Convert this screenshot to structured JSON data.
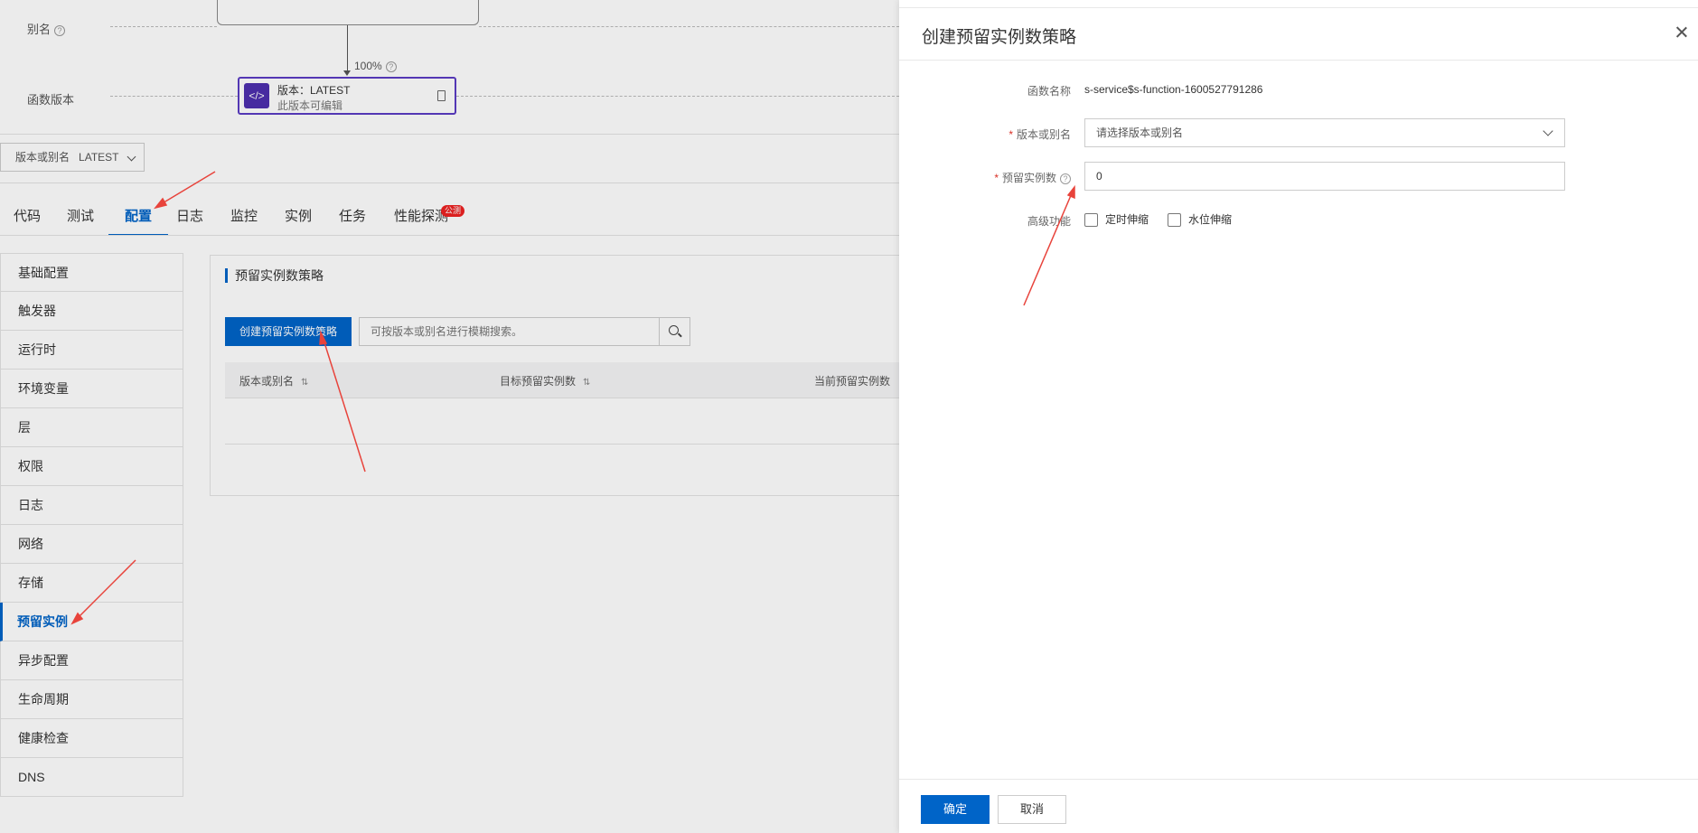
{
  "topology": {
    "alias_label": "别名",
    "version_label": "函数版本",
    "percent": "100%",
    "version_card_title": "版本：LATEST",
    "version_card_sub": "此版本可编辑"
  },
  "version_select": {
    "label": "版本或别名",
    "value": "LATEST"
  },
  "tabs": [
    {
      "label": "代码"
    },
    {
      "label": "测试"
    },
    {
      "label": "配置"
    },
    {
      "label": "日志"
    },
    {
      "label": "监控"
    },
    {
      "label": "实例"
    },
    {
      "label": "任务"
    },
    {
      "label": "性能探测"
    }
  ],
  "tab_badge": "公测",
  "sidebar": {
    "items": [
      {
        "label": "基础配置"
      },
      {
        "label": "触发器"
      },
      {
        "label": "运行时"
      },
      {
        "label": "环境变量"
      },
      {
        "label": "层"
      },
      {
        "label": "权限"
      },
      {
        "label": "日志"
      },
      {
        "label": "网络"
      },
      {
        "label": "存储"
      },
      {
        "label": "预留实例"
      },
      {
        "label": "异步配置"
      },
      {
        "label": "生命周期"
      },
      {
        "label": "健康检查"
      },
      {
        "label": "DNS"
      }
    ]
  },
  "panel": {
    "title": "预留实例数策略",
    "create_button": "创建预留实例数策略",
    "search_placeholder": "可按版本或别名进行模糊搜索。",
    "columns": [
      "版本或别名",
      "目标预留实例数",
      "当前预留实例数"
    ]
  },
  "drawer": {
    "title": "创建预留实例数策略",
    "function_name_label": "函数名称",
    "function_name_value": "s-service$s-function-1600527791286",
    "version_label": "版本或别名",
    "version_placeholder": "请选择版本或别名",
    "instances_label": "预留实例数",
    "instances_value": "0",
    "advanced_label": "高级功能",
    "option_scheduled": "定时伸缩",
    "option_watermark": "水位伸缩",
    "ok_button": "确定",
    "cancel_button": "取消"
  },
  "colors": {
    "primary": "#0064c8",
    "annotation_arrow": "#e8433b",
    "version_card_border": "#5b3cc4",
    "brand_mark": "#ff6a00"
  }
}
